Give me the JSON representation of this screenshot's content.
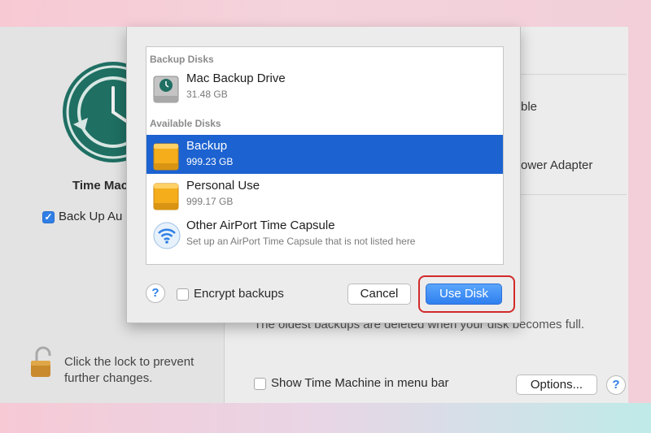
{
  "window": {
    "sidebar": {
      "title_fragment": "Time Mac",
      "backup_auto_fragment": "Back Up Au",
      "lock_text": "Click the lock to prevent further changes."
    },
    "right_fragments": [
      "ble",
      "ower Adapter",
      "The oldest backups are deleted when your disk becomes full."
    ],
    "menubar_option": "Show Time Machine in menu bar",
    "options_label": "Options...",
    "help_glyph": "?"
  },
  "sheet": {
    "backup_disks_label": "Backup Disks",
    "available_disks_label": "Available Disks",
    "backup_disks": [
      {
        "name": "Mac Backup Drive",
        "size": "31.48 GB"
      }
    ],
    "available_disks": [
      {
        "name": "Backup",
        "size": "999.23 GB",
        "selected": true
      },
      {
        "name": "Personal Use",
        "size": "999.17 GB",
        "selected": false
      },
      {
        "name": "Other AirPort Time Capsule",
        "size": "Set up an AirPort Time Capsule that is not listed here",
        "selected": false
      }
    ],
    "encrypt_label": "Encrypt backups",
    "cancel_label": "Cancel",
    "use_disk_label": "Use Disk",
    "help_glyph": "?"
  },
  "colors": {
    "selection": "#1c62d0",
    "primary_button": "#2f7ff0",
    "highlight_ring": "#d22a2a",
    "tm_icon": "#1f6f63"
  }
}
